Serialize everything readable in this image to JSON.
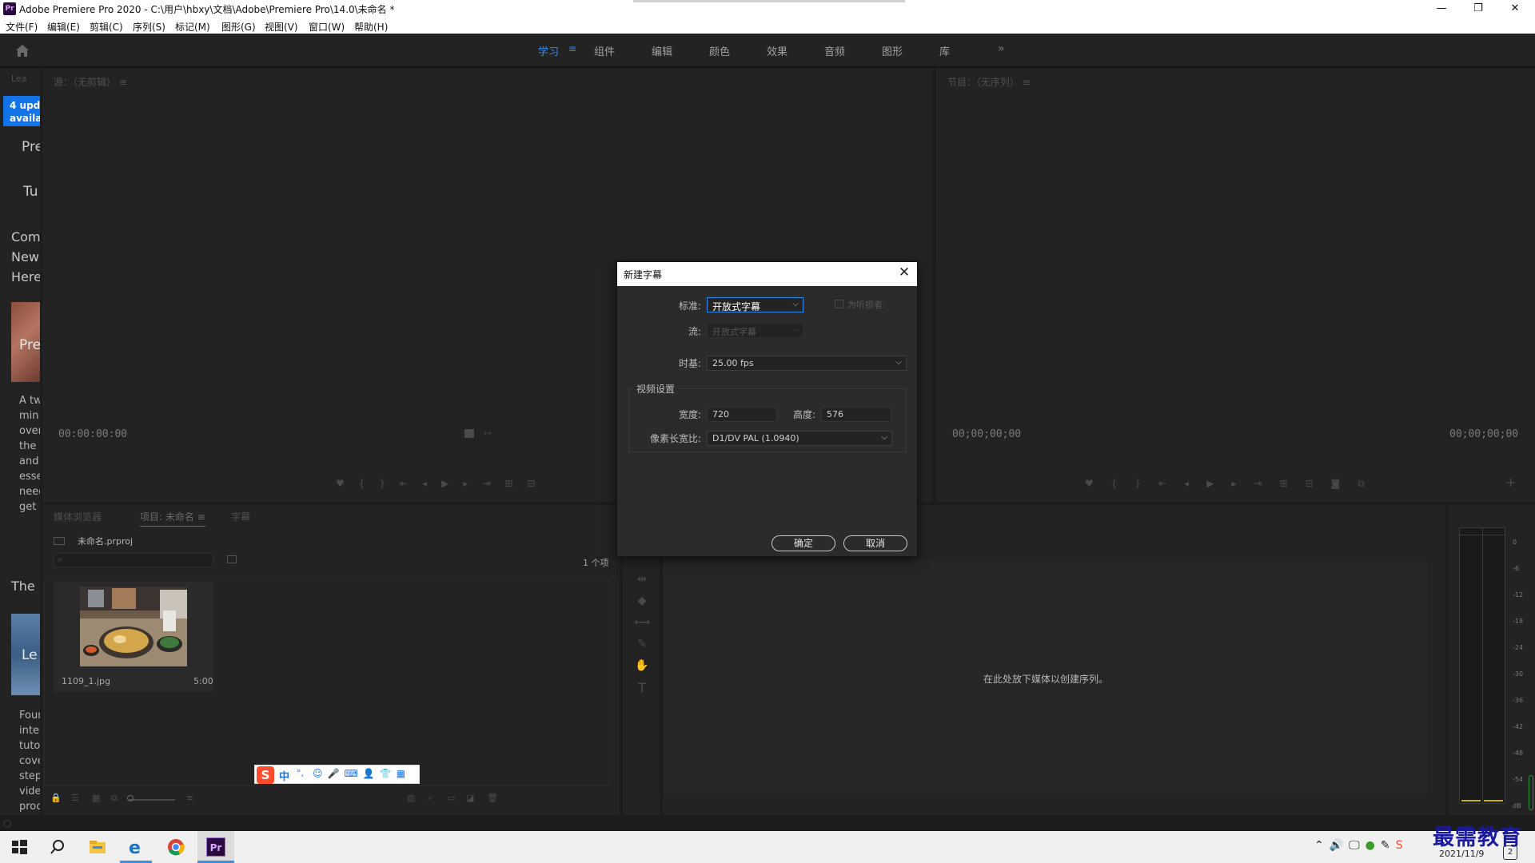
{
  "window": {
    "app_logo": "Pr",
    "title": "Adobe Premiere Pro 2020 - C:\\用户\\hbxy\\文档\\Adobe\\Premiere Pro\\14.0\\未命名 *",
    "minimize": "—",
    "restore": "❐",
    "close": "✕"
  },
  "menu": [
    "文件(F)",
    "编辑(E)",
    "剪辑(C)",
    "序列(S)",
    "标记(M)",
    "图形(G)",
    "视图(V)",
    "窗口(W)",
    "帮助(H)"
  ],
  "workspaces": {
    "items": [
      "学习",
      "组件",
      "编辑",
      "颜色",
      "效果",
      "音频",
      "图形",
      "库"
    ],
    "active": "学习",
    "active_menu_icon": "≡",
    "more": "»"
  },
  "learn_panel": {
    "header": "Lea",
    "badge_line1": "4 upd",
    "badge_line2": "availa",
    "headings": [
      "Pre",
      "Tu"
    ],
    "intro_lines": [
      "Com",
      "New",
      "Here"
    ],
    "card1_title": "Pre",
    "card1_desc": [
      "A tw",
      "min",
      "over",
      "the",
      "and",
      "esse",
      "need",
      "get"
    ],
    "section2": "The",
    "card2_title": "Le",
    "card2_desc": [
      "Four",
      "inte",
      "tuto",
      "cove",
      "step",
      "vide",
      "proc"
    ]
  },
  "source_monitor": {
    "header": "源：（无剪辑） ≡",
    "timecode": "00:00:00:00"
  },
  "program_monitor": {
    "header": "节目：（无序列） ≡",
    "timecode_left": "00;00;00;00",
    "timecode_right": "00;00;00;00",
    "add_button": "+"
  },
  "project_panel": {
    "tabs": [
      "媒体浏览器",
      "项目: 未命名",
      "字幕"
    ],
    "active_tab": "项目: 未命名",
    "tab_menu_icon": "≡",
    "project_file": "未命名.prproj",
    "item_count": "1 个项",
    "search_placeholder": "",
    "clip": {
      "name": "1109_1.jpg",
      "duration": "5:00"
    }
  },
  "timeline": {
    "empty_message": "在此处放下媒体以创建序列。"
  },
  "audio_meter": {
    "labels": [
      "0",
      "-6",
      "-12",
      "-18",
      "-24",
      "-30",
      "-36",
      "-42",
      "-48",
      "-54",
      "dB"
    ]
  },
  "dialog": {
    "title": "新建字幕",
    "close": "✕",
    "standard_label": "标准:",
    "standard_value": "开放式字幕",
    "hearing_checkbox_label": "为听损者:",
    "stream_label": "流:",
    "stream_value": "开放式字幕",
    "timebase_label": "时基:",
    "timebase_value": "25.00 fps",
    "video_settings_label": "视频设置",
    "width_label": "宽度:",
    "width_value": "720",
    "height_label": "高度:",
    "height_value": "576",
    "par_label": "像素长宽比:",
    "par_value": "D1/DV PAL (1.0940)",
    "ok": "确定",
    "cancel": "取消"
  },
  "ime_toolbar": {
    "logo": "S",
    "mode": "中",
    "punct": "°,",
    "items": [
      "☺",
      "🎤",
      "⌨",
      "👤",
      "👕",
      "▦"
    ]
  },
  "taskbar": {
    "date": "2021/11/9",
    "watermark": "最需教育",
    "notification_count": "2"
  },
  "colors": {
    "accent_blue": "#2d8ceb",
    "badge_blue": "#1473e6",
    "panel_bg": "#232323",
    "dialog_bg": "#2b2b2b",
    "watermark_blue": "#1a1aa0"
  }
}
